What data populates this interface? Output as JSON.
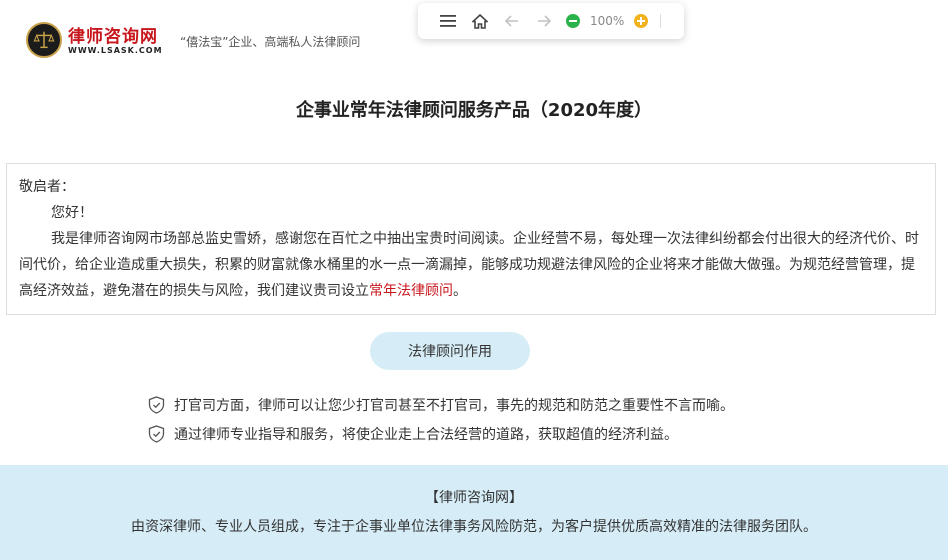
{
  "header": {
    "logo_title": "律师咨询网",
    "logo_subtitle": "WWW.LSASK.COM",
    "slogan": "“僖法宝”企业、高端私人法律顾问"
  },
  "toolbar": {
    "zoom_level": "100%",
    "icons": [
      "menu-icon",
      "home-icon",
      "back-arrow-icon",
      "forward-arrow-icon",
      "zoom-out-icon",
      "zoom-in-icon"
    ]
  },
  "page_title": "企事业常年法律顾问服务产品（2020年度）",
  "letter": {
    "salutation": "敬启者：",
    "greeting": "您好！",
    "body": "我是律师咨询网市场部总监史雪娇，感谢您在百忙之中抽出宝贵时间阅读。企业经营不易，每处理一次法律纠纷都会付出很大的经济代价、时间代价，给企业造成重大损失，积累的财富就像水桶里的水一点一滴漏掉，能够成功规避法律风险的企业将来才能做大做强。为规范经营管理，提高经济效益，避免潜在的损失与风险，我们建议贵司设立",
    "highlight": "常年法律顾问",
    "end": "。"
  },
  "section_label": "法律顾问作用",
  "benefits": [
    "打官司方面，律师可以让您少打官司甚至不打官司，事先的规范和防范之重要性不言而喻。",
    "通过律师专业指导和服务，将使企业走上合法经营的道路，获取超值的经济利益。"
  ],
  "footer": {
    "title": "【律师咨询网】",
    "description": "由资深律师、专业人员组成，专注于企事业单位法律事务风险防范，为客户提供优质高效精准的法律服务团队。"
  },
  "colors": {
    "brand_red": "#c8161d",
    "light_blue": "#d6edf7",
    "zoom_out_green": "#2ab34a",
    "zoom_in_yellow": "#f2b21c"
  }
}
